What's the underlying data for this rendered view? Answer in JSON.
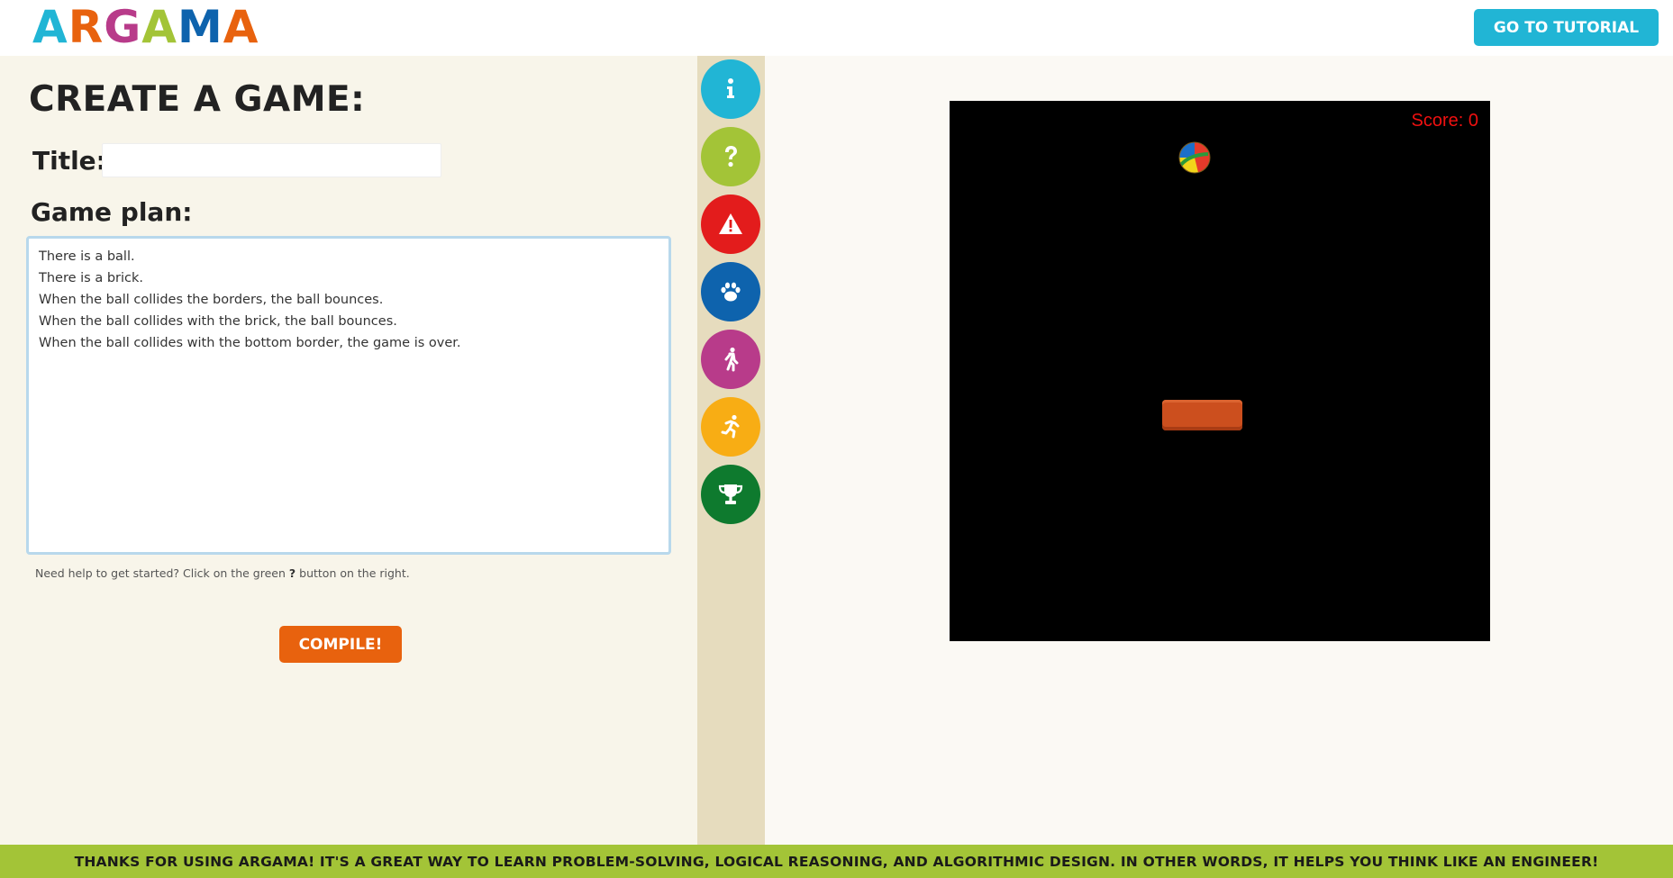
{
  "header": {
    "logo_letters": [
      {
        "char": "A",
        "color": "#21b5d5"
      },
      {
        "char": "R",
        "color": "#e8620e"
      },
      {
        "char": "G",
        "color": "#b83b8a"
      },
      {
        "char": "A",
        "color": "#a3c437"
      },
      {
        "char": "M",
        "color": "#0e63ad"
      },
      {
        "char": "A",
        "color": "#e8620e"
      }
    ],
    "tutorial_label": "GO TO TUTORIAL"
  },
  "editor": {
    "page_title": "CREATE A GAME:",
    "title_label": "Title:",
    "title_value": "",
    "plan_label": "Game plan:",
    "plan_lines": [
      "There is a ball.",
      "There is a brick.",
      "When the ball collides the borders, the ball bounces.",
      "When the ball collides with the brick, the ball bounces.",
      "When the ball collides with the bottom border, the game is over."
    ],
    "help_before": "Need help to get started? Click on the green",
    "help_symbol": "?",
    "help_after": "button on the right.",
    "compile_label": "COMPILE!"
  },
  "icon_column": {
    "items": [
      {
        "name": "info-icon",
        "color": "#21b5d5"
      },
      {
        "name": "help-icon",
        "color": "#a3c437"
      },
      {
        "name": "warning-icon",
        "color": "#e31c1c"
      },
      {
        "name": "paw-icon",
        "color": "#0e63ad"
      },
      {
        "name": "walking-icon",
        "color": "#b83b8a"
      },
      {
        "name": "running-icon",
        "color": "#f8ad14"
      },
      {
        "name": "trophy-icon",
        "color": "#0e7a2e"
      }
    ]
  },
  "game": {
    "score_text": "Score: 0"
  },
  "footer": {
    "message": "THANKS FOR USING ARGAMA! IT'S A GREAT WAY TO LEARN PROBLEM-SOLVING, LOGICAL REASONING, AND ALGORITHMIC DESIGN. IN OTHER WORDS, IT HELPS YOU THINK LIKE AN ENGINEER!"
  }
}
